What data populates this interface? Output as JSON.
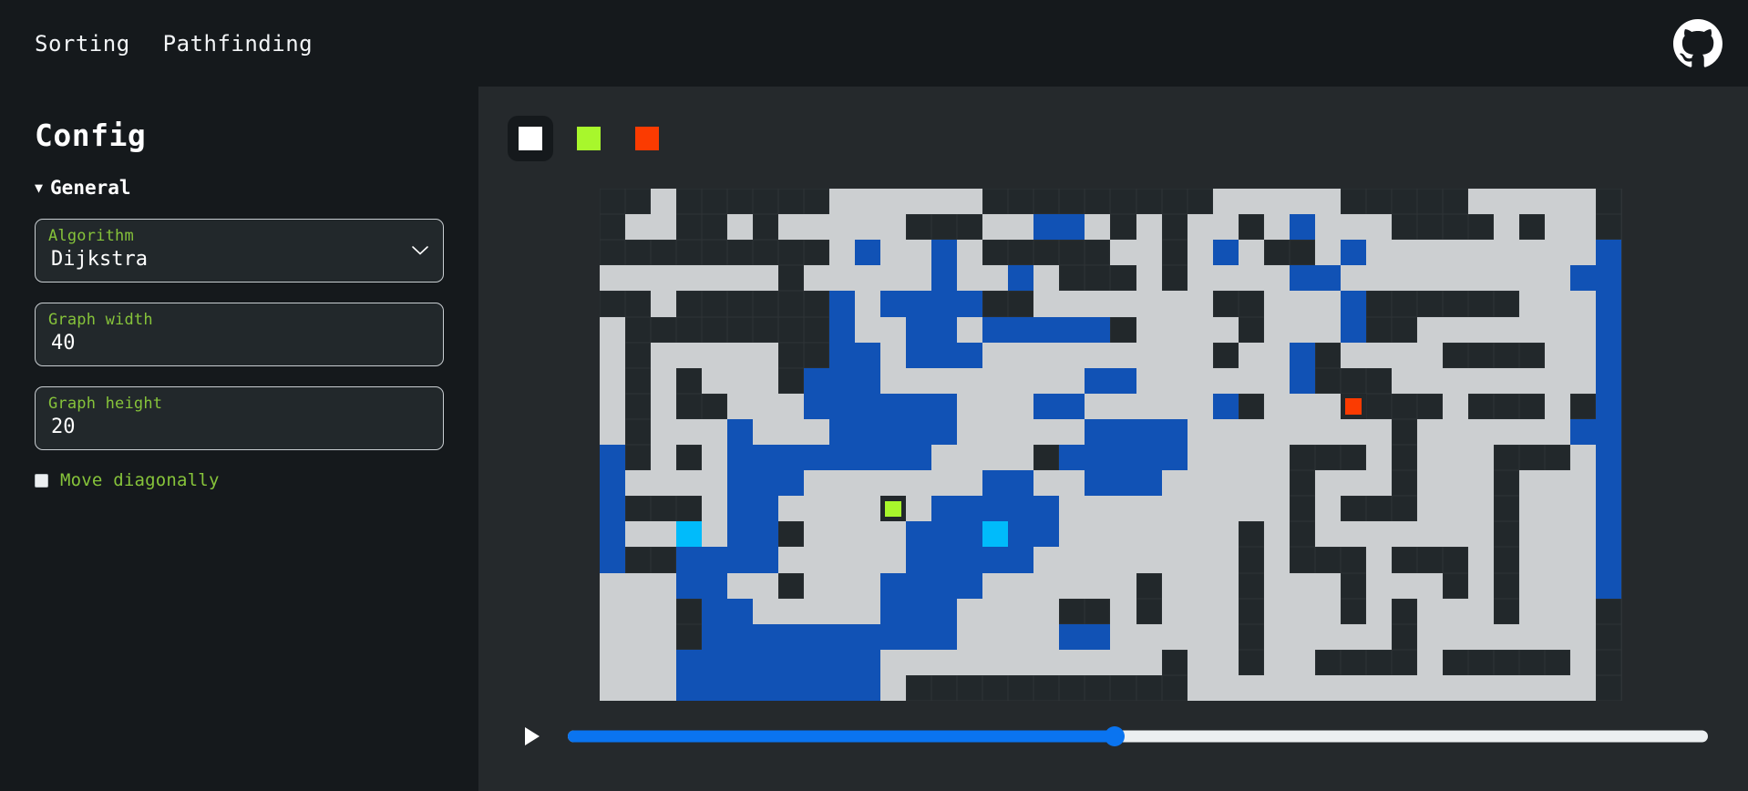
{
  "header": {
    "nav": [
      {
        "label": "Sorting",
        "icon": "none"
      },
      {
        "label": "Pathfinding",
        "icon": "none"
      }
    ],
    "github_icon": "github-icon"
  },
  "sidebar": {
    "title": "Config",
    "section": {
      "caret": "▼",
      "label": "General"
    },
    "fields": [
      {
        "label": "Algorithm",
        "value": "Dijkstra",
        "type": "select",
        "options": [
          "Dijkstra"
        ],
        "icon": "chevron-down-icon"
      },
      {
        "label": "Graph width",
        "value": "40",
        "type": "number"
      },
      {
        "label": "Graph height",
        "value": "20",
        "type": "number"
      }
    ],
    "checkbox": {
      "label": "Move diagonally",
      "checked": false
    }
  },
  "main": {
    "toolbar": [
      {
        "name": "wall-tool",
        "color": "#ffffff",
        "selected": true
      },
      {
        "name": "start-tool",
        "color": "#a8f72c",
        "selected": false
      },
      {
        "name": "end-tool",
        "color": "#fb3b01",
        "selected": false
      }
    ],
    "player": {
      "play_icon": "play-icon",
      "progress_percent": 48
    }
  },
  "colors": {
    "sidebar_bg": "#15191c",
    "main_bg": "#25292c",
    "label_green": "#86c33a",
    "wall": "#cccfd1",
    "empty": "#22282b",
    "visited": "#1152b5",
    "frontier": "#00bbfb",
    "start": "#a8f72c",
    "end": "#fb3b01",
    "accent_blue": "#0a74f0"
  },
  "chart_data": {
    "type": "heatmap",
    "title": "Pathfinding grid",
    "cols": 40,
    "rows": 20,
    "legend": [
      {
        "key": "0",
        "name": "empty",
        "color": "#22282b"
      },
      {
        "key": "1",
        "name": "wall",
        "color": "#cccfd1"
      },
      {
        "key": "2",
        "name": "visited",
        "color": "#1152b5"
      },
      {
        "key": "3",
        "name": "frontier",
        "color": "#00bbfb"
      },
      {
        "key": "4",
        "name": "start",
        "color": "#a8f72c"
      },
      {
        "key": "5",
        "name": "end",
        "color": "#fb3b01"
      }
    ],
    "grid": [
      "0010000001111110000000001111100000111110",
      "0110010111110001122101011012111000010110",
      "0000000001211210000011012100121111111112",
      "1111111011111211210001011112211111111122",
      "0010000002122220011111110011120000001112",
      "1000000002112212222201111011120011111112",
      "1011111002212221111111110112011110000112",
      "1010111022211111111221111112000111111112",
      "1010011122222211122111112011110001000102",
      "1011121112222211111222211111111011111122",
      "2010122222222111102222211110001011100012",
      "2111122211111112211222111110111011101112",
      "2000122111111222221111111110100011101112",
      "2111122011112223221111111010111111101112",
      "2002222111112222211111111010001000101112",
      "1112211011122221111110111011101110101112",
      "1110221111122211110010111011101011101110",
      "1110222222222211112211111011111011111110",
      "1112222222211111111111011011000010000010",
      "1112222222210000000000011111111111111110"
    ],
    "markers": [
      {
        "type": "start",
        "col": 11,
        "row": 12
      },
      {
        "type": "end",
        "col": 29,
        "row": 8
      },
      {
        "type": "frontier",
        "col": 3,
        "row": 13
      }
    ]
  }
}
